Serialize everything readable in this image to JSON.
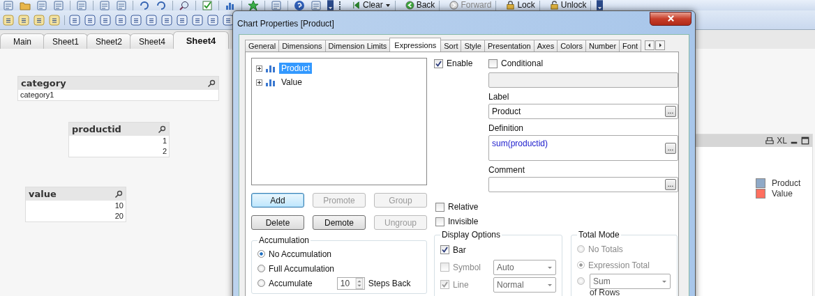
{
  "toolbar": {
    "buttons": [
      {
        "label": "Clear",
        "disabled": false,
        "kind": "dropdown"
      },
      {
        "label": "Back",
        "disabled": false,
        "kind": "back"
      },
      {
        "label": "Forward",
        "disabled": true,
        "kind": "forward"
      },
      {
        "label": "Lock",
        "disabled": false,
        "kind": "lock"
      },
      {
        "label": "Unlock",
        "disabled": false,
        "kind": "unlock"
      }
    ]
  },
  "sheet_tabs": [
    {
      "label": "Main",
      "selected": false
    },
    {
      "label": "Sheet1",
      "selected": false
    },
    {
      "label": "Sheet2",
      "selected": false
    },
    {
      "label": "Sheet4",
      "selected": false
    },
    {
      "label": "Sheet4",
      "selected": true
    }
  ],
  "listboxes": [
    {
      "title": "category",
      "kind": "text",
      "values": [
        "category1"
      ]
    },
    {
      "title": "productid",
      "kind": "numeric",
      "values": [
        "1",
        "2"
      ]
    },
    {
      "title": "value",
      "kind": "numeric",
      "values": [
        "10",
        "20"
      ]
    }
  ],
  "chart": {
    "export_label": "XL",
    "legend": [
      {
        "label": "Product",
        "color": "#8fa9c7"
      },
      {
        "label": "Value",
        "color": "#ff6f5f"
      }
    ]
  },
  "dialog": {
    "title": "Chart Properties [Product]",
    "tabs": [
      {
        "label": "General",
        "selected": false
      },
      {
        "label": "Dimensions",
        "selected": false
      },
      {
        "label": "Dimension Limits",
        "selected": false
      },
      {
        "label": "Expressions",
        "selected": true
      },
      {
        "label": "Sort",
        "selected": false
      },
      {
        "label": "Style",
        "selected": false
      },
      {
        "label": "Presentation",
        "selected": false
      },
      {
        "label": "Axes",
        "selected": false
      },
      {
        "label": "Colors",
        "selected": false
      },
      {
        "label": "Number",
        "selected": false
      },
      {
        "label": "Font",
        "selected": false
      }
    ],
    "expressions": [
      {
        "label": "Product",
        "selected": true
      },
      {
        "label": "Value",
        "selected": false
      }
    ],
    "enable": {
      "label": "Enable",
      "checked": true
    },
    "conditional": {
      "label": "Conditional",
      "checked": false
    },
    "fields": [
      {
        "label": "Label",
        "value": "Product",
        "button": "...",
        "kind": "text"
      },
      {
        "label": "Definition",
        "value": "sum(productid)",
        "button": "...",
        "kind": "code"
      },
      {
        "label": "Comment",
        "button": "...",
        "kind": "text"
      }
    ],
    "buttons": [
      {
        "label": "Add",
        "disabled": false,
        "default": true
      },
      {
        "label": "Promote",
        "disabled": true,
        "default": false
      },
      {
        "label": "Group",
        "disabled": true,
        "default": false
      },
      {
        "label": "Delete",
        "disabled": false,
        "default": false
      },
      {
        "label": "Demote",
        "disabled": false,
        "default": false
      },
      {
        "label": "Ungroup",
        "disabled": true,
        "default": false
      }
    ],
    "relative": {
      "label": "Relative",
      "checked": false
    },
    "invisible": {
      "label": "Invisible",
      "checked": false
    },
    "accumulation": {
      "title": "Accumulation",
      "options": [
        {
          "label": "No Accumulation",
          "selected": true
        },
        {
          "label": "Full Accumulation",
          "selected": false
        },
        {
          "label": "Accumulate",
          "selected": false
        }
      ],
      "steps": "10",
      "steps_label": "Steps Back"
    },
    "display_options": {
      "title": "Display Options",
      "items": [
        {
          "label": "Bar",
          "checked": true,
          "disabled": false
        },
        {
          "label": "Symbol",
          "checked": false,
          "disabled": true,
          "dropdown": "Auto"
        },
        {
          "label": "Line",
          "checked": true,
          "disabled": true,
          "dropdown": "Normal"
        }
      ]
    },
    "total_mode": {
      "title": "Total Mode",
      "options": [
        {
          "kind": "radio",
          "label": "No Totals",
          "selected": false,
          "disabled": true
        },
        {
          "kind": "radio",
          "label": "Expression Total",
          "selected": true,
          "disabled": true
        },
        {
          "kind": "dropdown",
          "value": "Sum",
          "selected": false,
          "disabled": true
        }
      ],
      "footer": "of Rows"
    }
  }
}
